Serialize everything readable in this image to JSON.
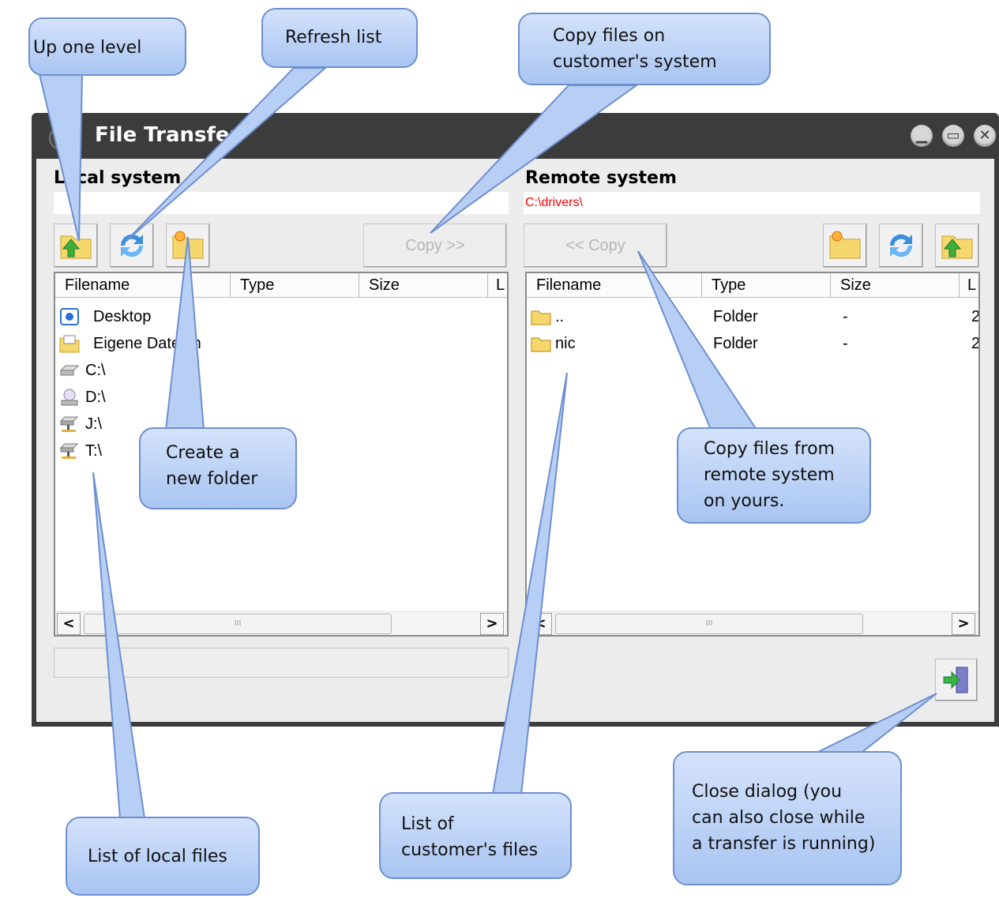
{
  "window": {
    "title": "File Transfer"
  },
  "titlebar_buttons": [
    {
      "name": "minimize-button",
      "glyph": "▁"
    },
    {
      "name": "maximize-button",
      "glyph": "▭"
    },
    {
      "name": "close-button",
      "glyph": "✕"
    }
  ],
  "local": {
    "heading": "Local system",
    "path": "",
    "copy_label": "Copy >>",
    "columns": [
      "Filename",
      "Type",
      "Size",
      "L"
    ],
    "rows": [
      {
        "name": "Desktop",
        "icon": "desktop-icon"
      },
      {
        "name": "Eigene Dateien",
        "icon": "documents-folder-icon"
      },
      {
        "name": "C:\\",
        "icon": "hard-drive-icon"
      },
      {
        "name": "D:\\",
        "icon": "cd-drive-icon"
      },
      {
        "name": "J:\\",
        "icon": "network-drive-icon"
      },
      {
        "name": "T:\\",
        "icon": "network-drive-icon"
      }
    ],
    "toolbar": [
      "up-one-level",
      "refresh-list",
      "create-new-folder"
    ]
  },
  "remote": {
    "heading": "Remote system",
    "path": "C:\\drivers\\",
    "copy_label": "<< Copy",
    "columns": [
      "Filename",
      "Type",
      "Size",
      "L"
    ],
    "rows": [
      {
        "name": "..",
        "type": "Folder",
        "size": "-",
        "l": "2",
        "icon": "folder-icon"
      },
      {
        "name": "nic",
        "type": "Folder",
        "size": "-",
        "l": "2",
        "icon": "folder-icon"
      }
    ],
    "toolbar": [
      "create-new-folder",
      "refresh-list",
      "up-one-level"
    ]
  },
  "scroll_thumb_grip": "III",
  "callouts": {
    "up_one_level": [
      "Up one level"
    ],
    "refresh_list": [
      "Refresh list"
    ],
    "copy_on_customer": [
      "Copy files on",
      "customer's system"
    ],
    "create_folder": [
      "Create a",
      "new folder"
    ],
    "copy_from_remote": [
      "Copy files from",
      "remote system",
      "on yours."
    ],
    "local_files": [
      "List of local files"
    ],
    "customer_files": [
      "List of",
      "customer's files"
    ],
    "close_dialog": [
      "Close dialog (you",
      "can also close while",
      "a transfer is running)"
    ]
  },
  "colors": {
    "titlebar": "#3c3c3c",
    "remote_path": "#ff0000",
    "callout_fill": "#b8cff5",
    "callout_border": "#6e8fcf"
  }
}
